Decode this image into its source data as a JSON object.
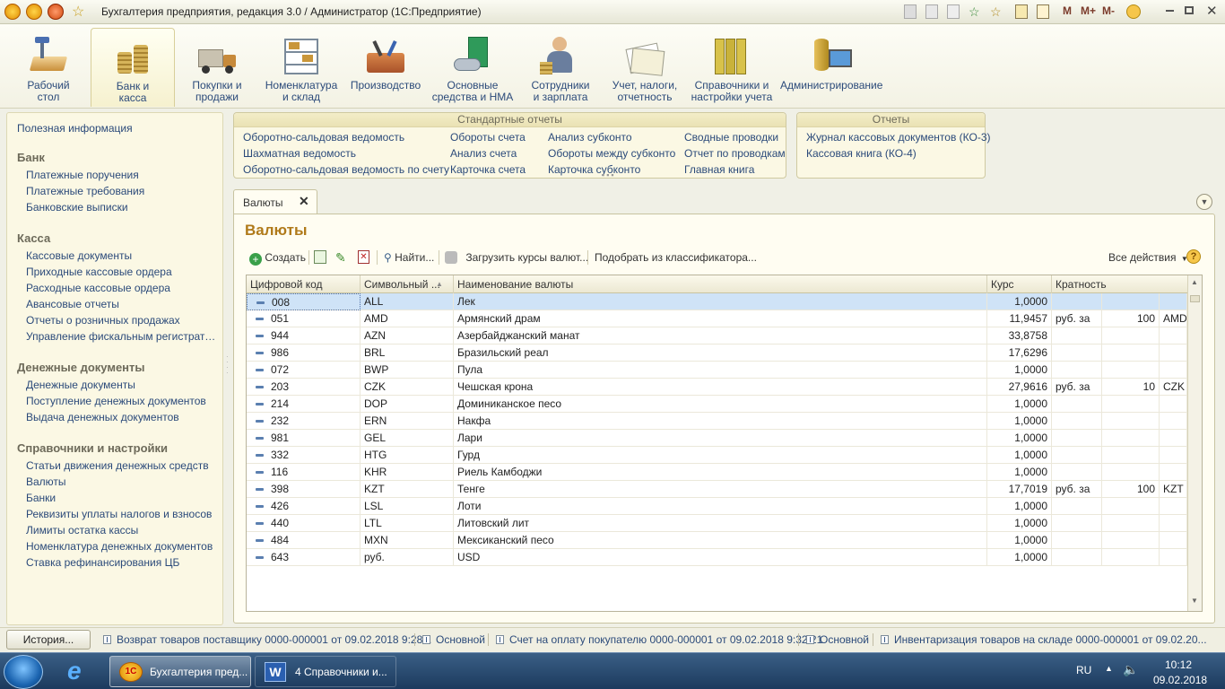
{
  "window": {
    "title": "Бухгалтерия предприятия, редакция 3.0 / Администратор  (1С:Предприятие)",
    "toolbar_right": [
      "M",
      "M+",
      "M-"
    ]
  },
  "sections": [
    {
      "label": "Рабочий\nстол",
      "icon": "desktop-icon",
      "active": false
    },
    {
      "label": "Банк и\nкасса",
      "icon": "bank-icon",
      "active": true
    },
    {
      "label": "Покупки и\nпродажи",
      "icon": "truck-icon",
      "active": false
    },
    {
      "label": "Номенклатура\nи склад",
      "icon": "warehouse-icon",
      "active": false
    },
    {
      "label": "Производство",
      "icon": "toolbox-icon",
      "active": false
    },
    {
      "label": "Основные\nсредства и НМА",
      "icon": "assets-icon",
      "active": false
    },
    {
      "label": "Сотрудники\nи зарплата",
      "icon": "employee-icon",
      "active": false
    },
    {
      "label": "Учет, налоги,\nотчетность",
      "icon": "reports-icon",
      "active": false
    },
    {
      "label": "Справочники и\nнастройки учета",
      "icon": "binders-icon",
      "active": false
    },
    {
      "label": "Администрирование",
      "icon": "admin-icon",
      "active": false
    }
  ],
  "leftnav": {
    "top_link": "Полезная информация",
    "groups": [
      {
        "title": "Банк",
        "items": [
          "Платежные поручения",
          "Платежные требования",
          "Банковские выписки"
        ]
      },
      {
        "title": "Касса",
        "items": [
          "Кассовые документы",
          "Приходные кассовые ордера",
          "Расходные кассовые ордера",
          "Авансовые отчеты",
          "Отчеты о розничных продажах",
          "Управление фискальным регистратором..."
        ]
      },
      {
        "title": "Денежные документы",
        "items": [
          "Денежные документы",
          "Поступление денежных документов",
          "Выдача денежных документов"
        ]
      },
      {
        "title": "Справочники и настройки",
        "items": [
          "Статьи движения денежных средств",
          "Валюты",
          "Банки",
          "Реквизиты уплаты налогов и взносов",
          "Лимиты остатка кассы",
          "Номенклатура денежных документов",
          "Ставка рефинансирования ЦБ"
        ]
      }
    ]
  },
  "reports": {
    "standard_title": "Стандартные отчеты",
    "standard_cols": [
      [
        "Оборотно-сальдовая ведомость",
        "Шахматная ведомость",
        "Оборотно-сальдовая ведомость по счету"
      ],
      [
        "Обороты счета",
        "Анализ счета",
        "Карточка счета"
      ],
      [
        "Анализ субконто",
        "Обороты между субконто",
        "Карточка субконто"
      ],
      [
        "Сводные проводки",
        "Отчет по проводкам",
        "Главная книга"
      ]
    ],
    "other_title": "Отчеты",
    "other_items": [
      "Журнал кассовых документов (КО-3)",
      "Кассовая книга (КО-4)"
    ]
  },
  "tab": {
    "label": "Валюты"
  },
  "form": {
    "title": "Валюты",
    "toolbar": {
      "create": "Создать",
      "find": "Найти...",
      "load_rates": "Загрузить курсы валют...",
      "pick": "Подобрать из классификатора...",
      "all_actions": "Все действия"
    }
  },
  "table": {
    "headers": [
      "Цифровой код",
      "Символьный ...",
      "Наименование валюты",
      "Курс",
      "Кратность"
    ],
    "rows": [
      {
        "code": "008",
        "sym": "ALL",
        "name": "Лек",
        "rate": "1,0000",
        "mult_prefix": "",
        "mult": "",
        "mult_sym": ""
      },
      {
        "code": "051",
        "sym": "AMD",
        "name": "Армянский драм",
        "rate": "11,9457",
        "mult_prefix": "руб. за",
        "mult": "100",
        "mult_sym": "AMD"
      },
      {
        "code": "944",
        "sym": "AZN",
        "name": "Азербайджанский манат",
        "rate": "33,8758",
        "mult_prefix": "",
        "mult": "",
        "mult_sym": ""
      },
      {
        "code": "986",
        "sym": "BRL",
        "name": "Бразильский реал",
        "rate": "17,6296",
        "mult_prefix": "",
        "mult": "",
        "mult_sym": ""
      },
      {
        "code": "072",
        "sym": "BWP",
        "name": "Пула",
        "rate": "1,0000",
        "mult_prefix": "",
        "mult": "",
        "mult_sym": ""
      },
      {
        "code": "203",
        "sym": "CZK",
        "name": "Чешская крона",
        "rate": "27,9616",
        "mult_prefix": "руб. за",
        "mult": "10",
        "mult_sym": "CZK"
      },
      {
        "code": "214",
        "sym": "DOP",
        "name": "Доминиканское песо",
        "rate": "1,0000",
        "mult_prefix": "",
        "mult": "",
        "mult_sym": ""
      },
      {
        "code": "232",
        "sym": "ERN",
        "name": "Накфа",
        "rate": "1,0000",
        "mult_prefix": "",
        "mult": "",
        "mult_sym": ""
      },
      {
        "code": "981",
        "sym": "GEL",
        "name": "Лари",
        "rate": "1,0000",
        "mult_prefix": "",
        "mult": "",
        "mult_sym": ""
      },
      {
        "code": "332",
        "sym": "HTG",
        "name": "Гурд",
        "rate": "1,0000",
        "mult_prefix": "",
        "mult": "",
        "mult_sym": ""
      },
      {
        "code": "116",
        "sym": "KHR",
        "name": "Риель Камбоджи",
        "rate": "1,0000",
        "mult_prefix": "",
        "mult": "",
        "mult_sym": ""
      },
      {
        "code": "398",
        "sym": "KZT",
        "name": "Тенге",
        "rate": "17,7019",
        "mult_prefix": "руб. за",
        "mult": "100",
        "mult_sym": "KZT"
      },
      {
        "code": "426",
        "sym": "LSL",
        "name": "Лоти",
        "rate": "1,0000",
        "mult_prefix": "",
        "mult": "",
        "mult_sym": ""
      },
      {
        "code": "440",
        "sym": "LTL",
        "name": "Литовский лит",
        "rate": "1,0000",
        "mult_prefix": "",
        "mult": "",
        "mult_sym": ""
      },
      {
        "code": "484",
        "sym": "MXN",
        "name": "Мексиканский песо",
        "rate": "1,0000",
        "mult_prefix": "",
        "mult": "",
        "mult_sym": ""
      },
      {
        "code": "643",
        "sym": "руб.",
        "name": "USD",
        "rate": "1,0000",
        "mult_prefix": "",
        "mult": "",
        "mult_sym": ""
      }
    ]
  },
  "history": {
    "button": "История...",
    "items": [
      "Возврат товаров поставщику 0000-000001 от 09.02.2018 9:28...",
      "Основной",
      "Счет на оплату покупателю 0000-000001 от 09.02.2018 9:32:21",
      "Основной",
      "Инвентаризация товаров на складе 0000-000001 от 09.02.20..."
    ]
  },
  "taskbar": {
    "tasks": [
      {
        "label": "Бухгалтерия пред...",
        "icon": "onec-icon"
      },
      {
        "label": "4 Справочники и...",
        "icon": "word-icon"
      }
    ],
    "lang": "RU",
    "time": "10:12",
    "date": "09.02.2018"
  },
  "colors": {
    "accent": "#b07a1a",
    "link": "#2b4a7a",
    "selection": "#cfe3f7"
  }
}
